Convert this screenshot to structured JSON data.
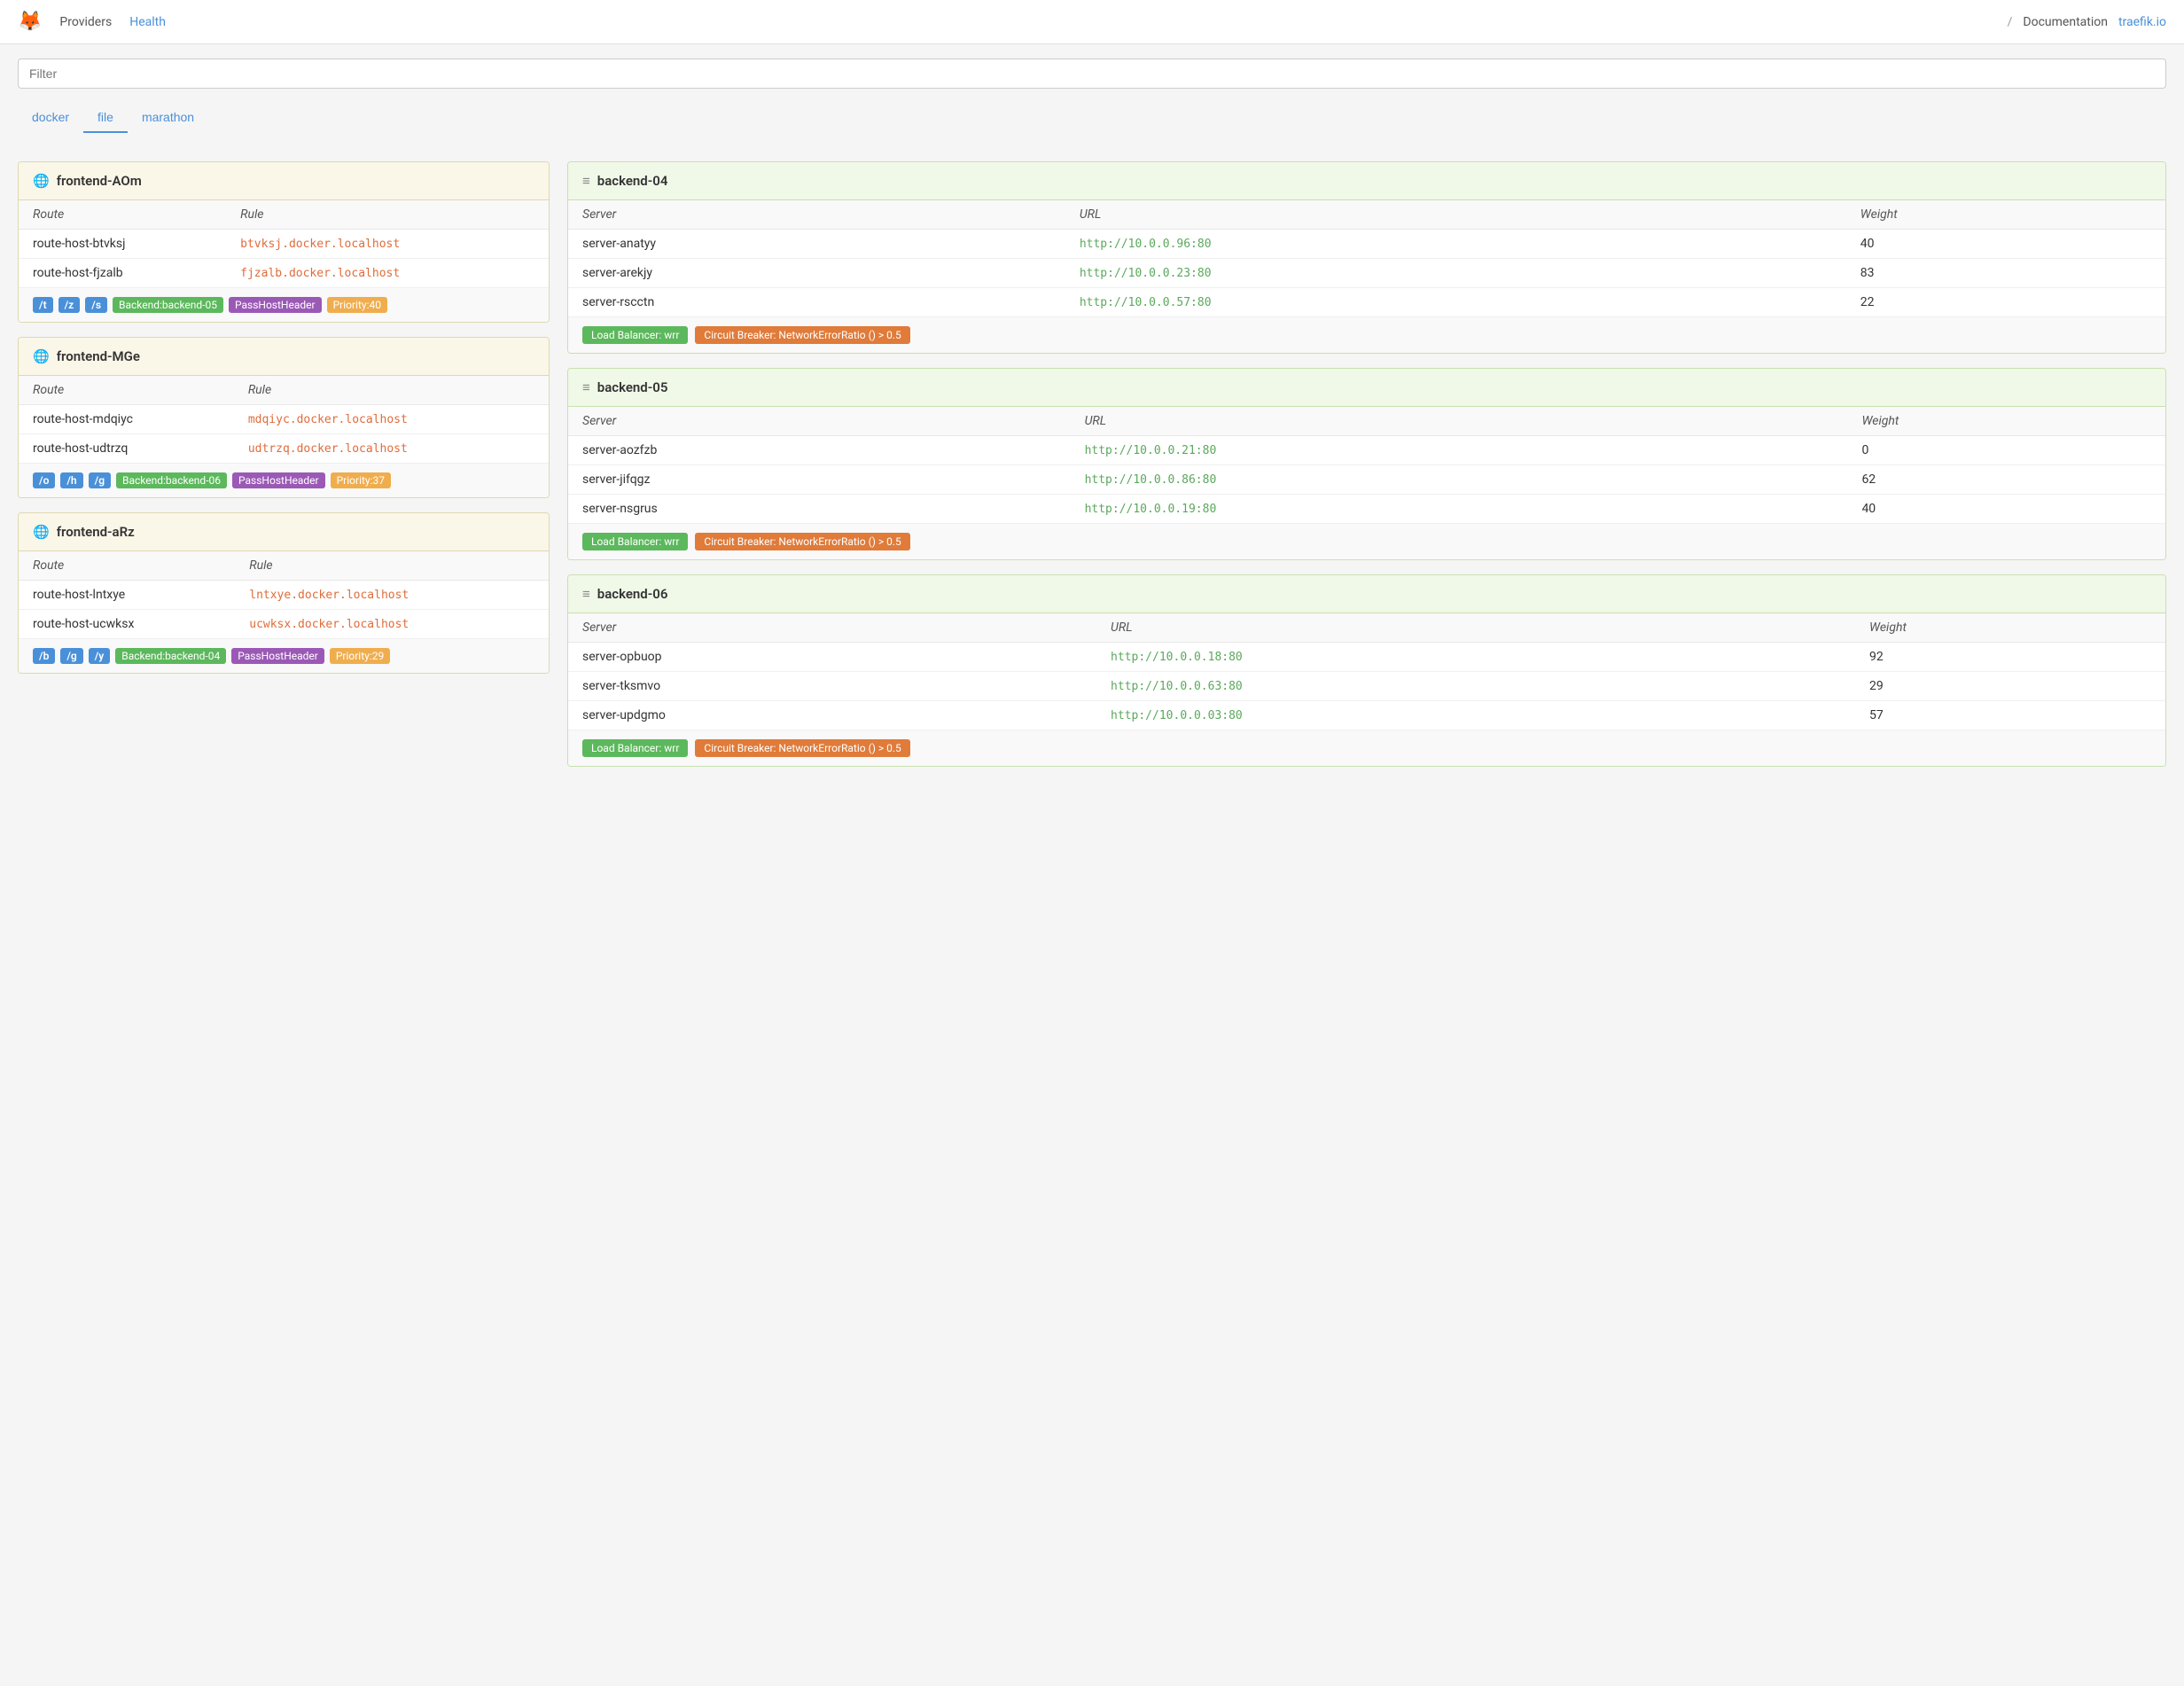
{
  "navbar": {
    "logo": "🦊",
    "links": [
      {
        "label": "Providers",
        "active": false
      },
      {
        "label": "Health",
        "active": false
      }
    ],
    "separator": "/",
    "doc_label": "Documentation",
    "traefik_label": "traefik.io",
    "traefik_url": "https://traefik.io"
  },
  "filter": {
    "placeholder": "Filter",
    "value": ""
  },
  "tabs": [
    {
      "label": "docker",
      "active": false
    },
    {
      "label": "file",
      "active": true
    },
    {
      "label": "marathon",
      "active": false
    }
  ],
  "frontends": [
    {
      "id": "frontend-AOm",
      "title": "frontend-AOm",
      "routes": [
        {
          "route": "route-host-btvksj",
          "rule": "btvksj.docker.localhost"
        },
        {
          "route": "route-host-fjzalb",
          "rule": "fjzalb.docker.localhost"
        }
      ],
      "tags_blue": [
        "/t",
        "/z",
        "/s"
      ],
      "tag_backend": "Backend:backend-05",
      "tag_pass": "PassHostHeader",
      "tag_priority": "Priority:40"
    },
    {
      "id": "frontend-MGe",
      "title": "frontend-MGe",
      "routes": [
        {
          "route": "route-host-mdqiyc",
          "rule": "mdqiyc.docker.localhost"
        },
        {
          "route": "route-host-udtrzq",
          "rule": "udtrzq.docker.localhost"
        }
      ],
      "tags_blue": [
        "/o",
        "/h",
        "/g"
      ],
      "tag_backend": "Backend:backend-06",
      "tag_pass": "PassHostHeader",
      "tag_priority": "Priority:37"
    },
    {
      "id": "frontend-aRz",
      "title": "frontend-aRz",
      "routes": [
        {
          "route": "route-host-lntxye",
          "rule": "lntxye.docker.localhost"
        },
        {
          "route": "route-host-ucwksx",
          "rule": "ucwksx.docker.localhost"
        }
      ],
      "tags_blue": [
        "/b",
        "/g",
        "/y"
      ],
      "tag_backend": "Backend:backend-04",
      "tag_pass": "PassHostHeader",
      "tag_priority": "Priority:29"
    }
  ],
  "backends": [
    {
      "id": "backend-04",
      "title": "backend-04",
      "servers": [
        {
          "name": "server-anatyy",
          "url": "http://10.0.0.96:80",
          "weight": 40
        },
        {
          "name": "server-arekjy",
          "url": "http://10.0.0.23:80",
          "weight": 83
        },
        {
          "name": "server-rscctn",
          "url": "http://10.0.0.57:80",
          "weight": 22
        }
      ],
      "badge_lb": "Load Balancer: wrr",
      "badge_cb": "Circuit Breaker: NetworkErrorRatio () > 0.5"
    },
    {
      "id": "backend-05",
      "title": "backend-05",
      "servers": [
        {
          "name": "server-aozfzb",
          "url": "http://10.0.0.21:80",
          "weight": 0
        },
        {
          "name": "server-jifqgz",
          "url": "http://10.0.0.86:80",
          "weight": 62
        },
        {
          "name": "server-nsgrus",
          "url": "http://10.0.0.19:80",
          "weight": 40
        }
      ],
      "badge_lb": "Load Balancer: wrr",
      "badge_cb": "Circuit Breaker: NetworkErrorRatio () > 0.5"
    },
    {
      "id": "backend-06",
      "title": "backend-06",
      "servers": [
        {
          "name": "server-opbuop",
          "url": "http://10.0.0.18:80",
          "weight": 92
        },
        {
          "name": "server-tksmvo",
          "url": "http://10.0.0.63:80",
          "weight": 29
        },
        {
          "name": "server-updgmo",
          "url": "http://10.0.0.03:80",
          "weight": 57
        }
      ],
      "badge_lb": "Load Balancer: wrr",
      "badge_cb": "Circuit Breaker: NetworkErrorRatio () > 0.5"
    }
  ],
  "col_headers": {
    "route": "Route",
    "rule": "Rule",
    "server": "Server",
    "url": "URL",
    "weight": "Weight"
  }
}
